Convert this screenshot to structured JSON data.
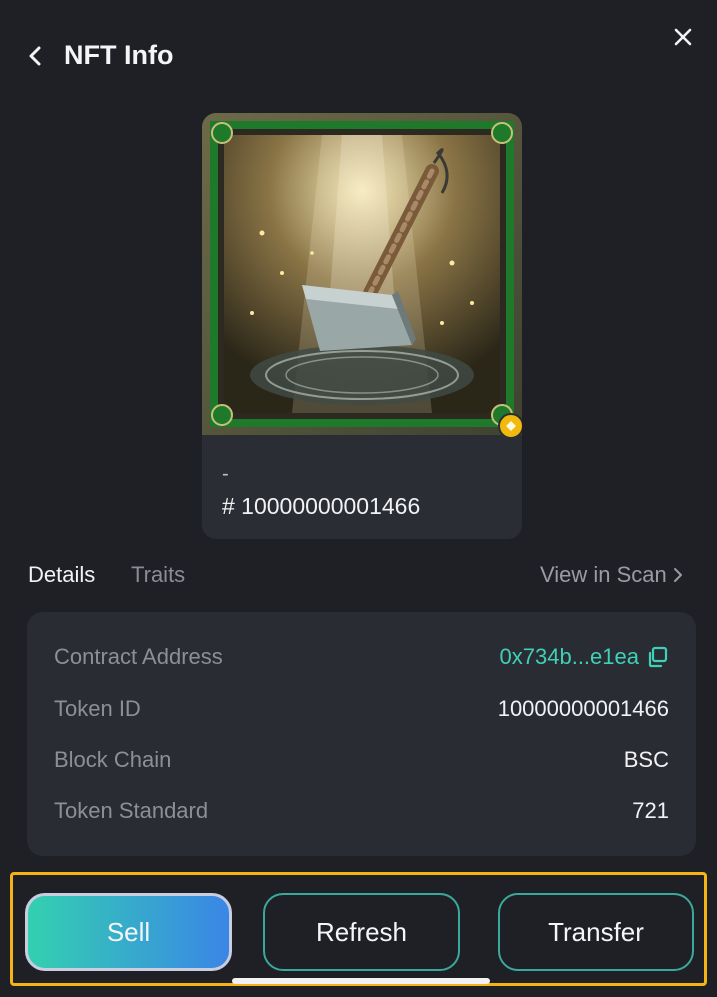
{
  "header": {
    "title": "NFT Info"
  },
  "nft": {
    "name": "-",
    "token_label": "# 10000000001466"
  },
  "tabs": {
    "details": "Details",
    "traits": "Traits"
  },
  "scan_link": {
    "label": "View in Scan"
  },
  "details": {
    "contract_address": {
      "label": "Contract Address",
      "value": "0x734b...e1ea"
    },
    "token_id": {
      "label": "Token ID",
      "value": "10000000001466"
    },
    "block_chain": {
      "label": "Block Chain",
      "value": "BSC"
    },
    "token_standard": {
      "label": "Token Standard",
      "value": "721"
    }
  },
  "actions": {
    "sell": "Sell",
    "refresh": "Refresh",
    "transfer": "Transfer"
  },
  "colors": {
    "accent": "#3fd0b8",
    "highlight": "#f5b316",
    "background": "#1f2026"
  }
}
